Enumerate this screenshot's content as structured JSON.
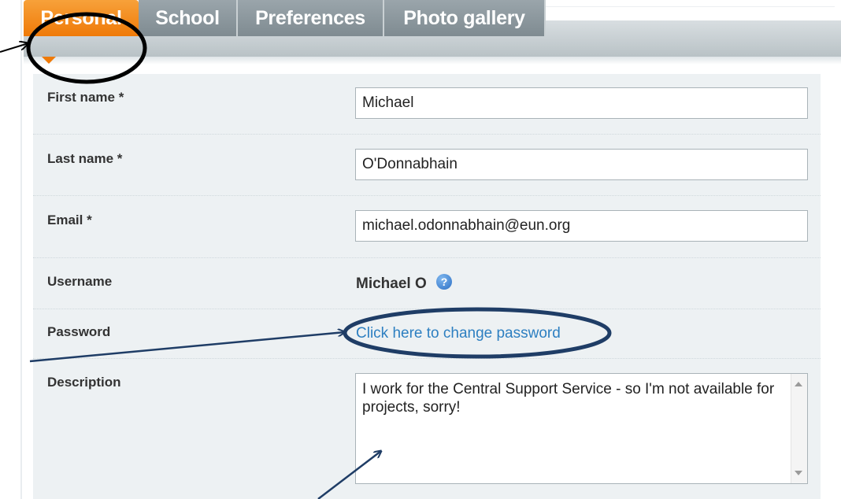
{
  "tabs": [
    {
      "label": "Personal",
      "active": true
    },
    {
      "label": "School",
      "active": false
    },
    {
      "label": "Preferences",
      "active": false
    },
    {
      "label": "Photo gallery",
      "active": false
    }
  ],
  "form": {
    "first_name": {
      "label": "First name *",
      "value": "Michael"
    },
    "last_name": {
      "label": "Last name *",
      "value": "O'Donnabhain"
    },
    "email": {
      "label": "Email *",
      "value": "michael.odonnabhain@eun.org"
    },
    "username": {
      "label": "Username",
      "value": "Michael O",
      "help_icon": "question-icon"
    },
    "password": {
      "label": "Password",
      "link": "Click here to change password"
    },
    "description": {
      "label": "Description",
      "value": "I work for the Central Support Service - so I'm not available for projects, sorry!"
    }
  },
  "colors": {
    "active_tab": "#ef7a08",
    "inactive_tab": "#8a969c",
    "panel_bg": "#edf1f3",
    "link": "#2d7fc1",
    "annotation_circle_black": "#000000",
    "annotation_circle_blue": "#1f3d66",
    "annotation_arrow": "#1f3d66"
  }
}
